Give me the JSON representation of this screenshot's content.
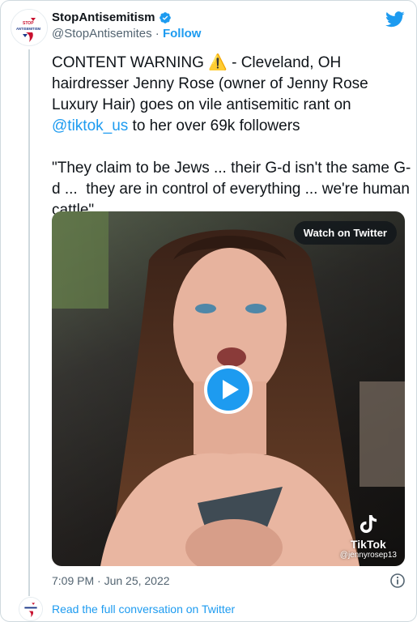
{
  "author": {
    "name": "StopAntisemitism",
    "handle": "@StopAntisemites",
    "separator": " · ",
    "follow_label": "Follow",
    "logo_text_top": "STOP",
    "logo_text_bottom": "ANTISEMITISM"
  },
  "tweet": {
    "text_part1": "CONTENT WARNING ⚠️ - Cleveland, OH hairdresser Jenny Rose (owner of Jenny Rose Luxury Hair) goes on vile antisemitic rant on ",
    "mention": "@tiktok_us",
    "text_part2": " to her over 69k followers\n\n\"They claim to be Jews ... their G-d isn't the same G-d ...  they are in control of everything ... we're human cattle\""
  },
  "media": {
    "watch_label": "Watch on Twitter",
    "watermark_name": "TikTok",
    "watermark_handle": "@jennyrosep13"
  },
  "meta": {
    "timestamp": "7:09 PM · Jun 25, 2022"
  },
  "footer": {
    "read_link": "Read the full conversation on Twitter"
  },
  "colors": {
    "accent": "#1d9bf0",
    "text": "#0f1419",
    "secondary": "#536471",
    "border": "#cfd9de"
  },
  "icons": {
    "twitter": "twitter-bird-icon",
    "verified": "verified-badge-icon",
    "play": "play-icon",
    "info": "info-icon"
  }
}
